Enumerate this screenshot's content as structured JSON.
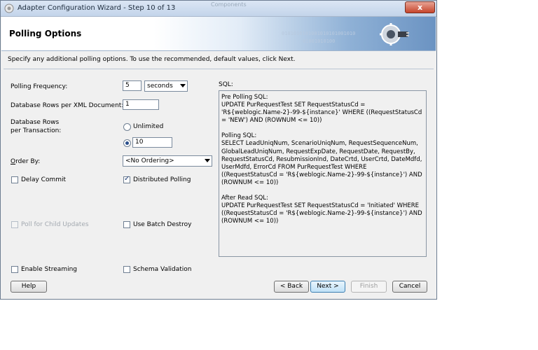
{
  "window": {
    "title": "Adapter Configuration Wizard - Step 10 of 13",
    "ghost_title": "Components",
    "close_label": "x"
  },
  "banner": {
    "title": "Polling Options",
    "digits_top": "0101010101001010101001010",
    "digits_bottom": "01001010100"
  },
  "instructions": "Specify any additional polling options.  To use the recommended, default values, click Next.",
  "form": {
    "polling_frequency": {
      "label": "Polling Frequency:",
      "value": "5",
      "unit": "seconds"
    },
    "rows_per_xml": {
      "label": "Database Rows per XML Document:",
      "value": "1"
    },
    "rows_per_txn": {
      "label_line1": "Database Rows",
      "label_line2": "per Transaction:",
      "unlimited_label": "Unlimited",
      "unlimited_selected": false,
      "value": "10",
      "value_selected": true
    },
    "order_by": {
      "label": "Order By:",
      "value": "<No Ordering>"
    },
    "delay_commit": {
      "label": "Delay Commit",
      "checked": false
    },
    "distributed_polling": {
      "label": "Distributed Polling",
      "checked": true
    },
    "poll_child_updates": {
      "label": "Poll for Child Updates",
      "checked": false,
      "enabled": false
    },
    "use_batch_destroy": {
      "label": "Use Batch Destroy",
      "checked": false
    },
    "enable_streaming": {
      "label": "Enable Streaming",
      "checked": false
    },
    "schema_validation": {
      "label": "Schema Validation",
      "checked": false
    }
  },
  "sql": {
    "label": "SQL:",
    "pre_polling_title": "Pre Polling SQL:",
    "pre_polling_body": "UPDATE PurRequestTest SET RequestStatusCd = 'R${weblogic.Name-2}-99-${instance}' WHERE ((RequestStatusCd = 'NEW') AND (ROWNUM <= 10))",
    "polling_title": "Polling SQL:",
    "polling_body": "SELECT LeadUniqNum, ScenarioUniqNum, RequestSequenceNum, GlobalLeadUniqNum, RequestExpDate, RequestDate, RequestBy, RequestStatusCd, ResubmissionInd, DateCrtd, UserCrtd, DateMdfd, UserMdfd, ErrorCd FROM PurRequestTest WHERE ((RequestStatusCd = 'R${weblogic.Name-2}-99-${instance}') AND (ROWNUM <= 10))",
    "after_read_title": "After Read SQL:",
    "after_read_body": "UPDATE PurRequestTest SET RequestStatusCd = 'Initiated' WHERE ((RequestStatusCd = 'R${weblogic.Name-2}-99-${instance}') AND (ROWNUM <= 10))"
  },
  "buttons": {
    "help": "Help",
    "back": "< Back",
    "next": "Next >",
    "finish": "Finish",
    "cancel": "Cancel"
  }
}
